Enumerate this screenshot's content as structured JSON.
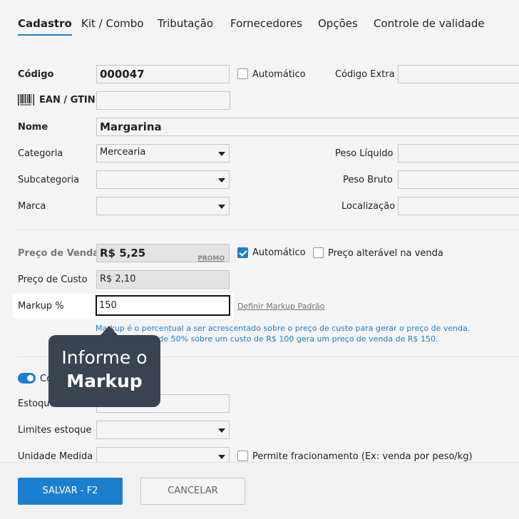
{
  "tabs": [
    {
      "label": "Cadastro"
    },
    {
      "label": "Kit / Combo"
    },
    {
      "label": "Tributação"
    },
    {
      "label": "Fornecedores"
    },
    {
      "label": "Opções"
    },
    {
      "label": "Controle de validade"
    }
  ],
  "form": {
    "codigo_label": "Código",
    "codigo_value": "000047",
    "automatico_label": "Automático",
    "codigo_extra_label": "Código Extra",
    "codigo_extra_value": "",
    "ean_label": "EAN / GTIN",
    "ean_value": "",
    "nome_label": "Nome",
    "nome_value": "Margarina",
    "categoria_label": "Categoria",
    "categoria_value": "Mercearia",
    "peso_liquido_label": "Peso Líquido",
    "subcategoria_label": "Subcategoria",
    "subcategoria_value": "",
    "peso_bruto_label": "Peso Bruto",
    "marca_label": "Marca",
    "marca_value": "",
    "localizacao_label": "Localização"
  },
  "pricing": {
    "preco_venda_label": "Preço de Venda",
    "preco_venda_value": "R$ 5,25",
    "promo_label": "PROMO",
    "automatico_label": "Automático",
    "automatico_checked": true,
    "preco_alteravel_label": "Preço alterável na venda",
    "preco_alteravel_checked": false,
    "preco_custo_label": "Preço de Custo",
    "preco_custo_value": "R$ 2,10",
    "markup_label": "Markup %",
    "markup_value": "150",
    "definir_markup_link": "Definir Markup Padrão",
    "help_line1": "Markup é o percentual a ser acrescentado sobre o preço de custo para gerar o preço de venda.",
    "help_line2": "Ex: Um markup de 50% sobre um custo de R$ 100 gera um preço de venda de R$ 150."
  },
  "stock": {
    "toggle_label_partial": "Co",
    "estoque_label": "Estoque",
    "limites_label": "Limites estoque",
    "unidade_label": "Unidade Medida",
    "fracionamento_label": "Permite fracionamento (Ex: venda por peso/kg)"
  },
  "tooltip": {
    "line1": "Informe o",
    "line2": "Markup"
  },
  "footer": {
    "save_label": "SALVAR - F2",
    "cancel_label": "CANCELAR"
  },
  "colors": {
    "accent": "#1b7fd0",
    "tooltip_bg": "#3a4351"
  }
}
